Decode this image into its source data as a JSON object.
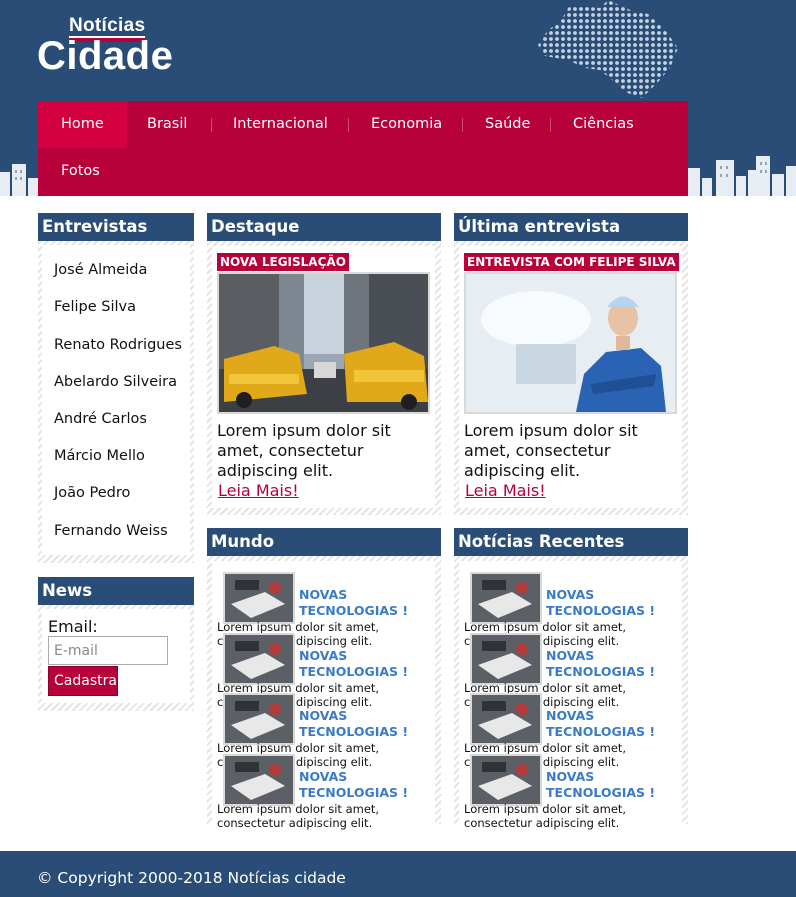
{
  "logo": {
    "small": "Notícias",
    "big": "Cidade"
  },
  "nav": {
    "items": [
      "Home",
      "Brasil",
      "Internacional",
      "Economia",
      "Saúde",
      "Ciências",
      "Fotos"
    ]
  },
  "entrevistas": {
    "title": "Entrevistas",
    "names": [
      "José Almeida",
      "Felipe Silva",
      "Renato Rodrigues",
      "Abelardo Silveira",
      "André Carlos",
      "Márcio Mello",
      "João Pedro",
      "Fernando Weiss"
    ]
  },
  "news_box": {
    "title": "News",
    "email_label": "Email:",
    "email_placeholder": "E-mail",
    "submit": "Cadastrar"
  },
  "destaque": {
    "title": "Destaque",
    "tag": "NOVA LEGISLAÇÃO",
    "text": "Lorem ipsum dolor sit amet, consectetur adipiscing elit.",
    "more": "Leia Mais!"
  },
  "ultima": {
    "title": "Última entrevista",
    "tag": "ENTREVISTA COM FELIPE SILVA",
    "text": "Lorem ipsum dolor sit amet, consectetur adipiscing elit.",
    "more": "Leia Mais!"
  },
  "mundo": {
    "title": "Mundo",
    "items": [
      {
        "title": "NOVAS TECNOLOGIAS !",
        "text": "Lorem ipsum dolor sit amet, consectetur adipiscing elit."
      },
      {
        "title": "NOVAS TECNOLOGIAS !",
        "text": "Lorem ipsum dolor sit amet, consectetur adipiscing elit."
      },
      {
        "title": "NOVAS TECNOLOGIAS !",
        "text": "Lorem ipsum dolor sit amet, consectetur adipiscing elit."
      },
      {
        "title": "NOVAS TECNOLOGIAS !",
        "text": "Lorem ipsum dolor sit amet, consectetur adipiscing elit."
      }
    ]
  },
  "recentes": {
    "title": "Notícias Recentes",
    "items": [
      {
        "title": "NOVAS TECNOLOGIAS !",
        "text": "Lorem ipsum dolor sit amet, consectetur adipiscing elit."
      },
      {
        "title": "NOVAS TECNOLOGIAS !",
        "text": "Lorem ipsum dolor sit amet, consectetur adipiscing elit."
      },
      {
        "title": "NOVAS TECNOLOGIAS !",
        "text": "Lorem ipsum dolor sit amet, consectetur adipiscing elit."
      },
      {
        "title": "NOVAS TECNOLOGIAS !",
        "text": "Lorem ipsum dolor sit amet, consectetur adipiscing elit."
      }
    ]
  },
  "footer": {
    "text": "© Copyright 2000-2018 Notícias cidade"
  },
  "colors": {
    "navy": "#2a4d77",
    "crimson": "#b8003a",
    "link_blue": "#3a7bc8"
  }
}
